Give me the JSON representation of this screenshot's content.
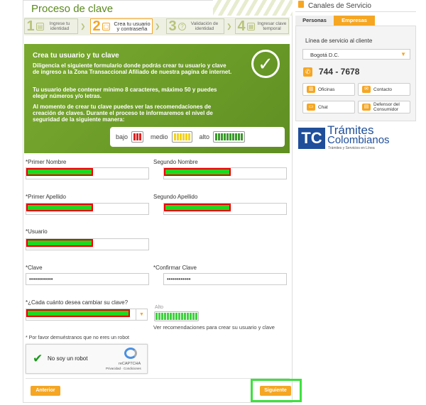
{
  "header": {
    "title": "Proceso de clave"
  },
  "steps": [
    {
      "num": "1",
      "label": "Ingrese tu identidad"
    },
    {
      "num": "2",
      "label": "Crea tu usuario y contraseña"
    },
    {
      "num": "3",
      "label": "Validación de identidad"
    },
    {
      "num": "4",
      "label": "Ingresar clave temporal"
    }
  ],
  "intro": {
    "heading": "Crea tu usuario y tu clave",
    "p1": "Diligencia el siguiente formulario donde podrás crear tu usuario y clave de ingreso a la Zona Transaccional Afiliado de nuestra pagina de internet.",
    "p2": "Tu usuario debe contener mínimo 8 caracteres, máximo 50 y puedes elegir números y/o letras.",
    "p3": "Al momento de crear tu clave puedes ver las recomendaciones de creación de claves. Durante el proceso te informaremos el nivel de seguridad de la siguiente manera:",
    "low": "bajo",
    "mid": "medio",
    "high": "alto"
  },
  "form": {
    "primer_nombre": "*Primer Nombre",
    "segundo_nombre": "Segundo Nombre",
    "primer_apellido": "*Primer Apellido",
    "segundo_apellido": "Segundo Apellido",
    "usuario": "*Usuario",
    "clave": "*Clave",
    "confirmar_clave": "*Confirmar Clave",
    "clave_value": "••••••••••••",
    "confirmar_value": "••••••••••••",
    "frecuencia": "*¿Cada cuánto desea cambiar su clave?",
    "strength": "Alto",
    "recomendaciones": "Ver recomendaciones para crear su usuario y clave",
    "robot_prompt": "* Por favor demuéstranos que no eres un robot",
    "robot_label": "No soy un robot",
    "recaptcha": "reCAPTCHA",
    "recaptcha_links": "Privacidad · Condiciones",
    "anterior": "Anterior",
    "siguiente": "Siguiente"
  },
  "sidebar": {
    "title": "Canales de Servicio",
    "tab_personas": "Personas",
    "tab_empresas": "Empresas",
    "linea": "Línea de servicio al cliente",
    "city": "Bogotá D.C.",
    "phone": "744 - 7678",
    "oficinas": "Oficinas",
    "contacto": "Contacto",
    "chat": "Chat",
    "defensor": "Defensor del Consumidor",
    "brand_tc": "TC",
    "brand_line1": "Trámites",
    "brand_line2": "Colombianos",
    "brand_tag": "Trámites y Servicios en Línea"
  },
  "colors": {
    "green": "#6a9a27",
    "orange": "#f5a623",
    "highlight": "#3ee03e"
  }
}
